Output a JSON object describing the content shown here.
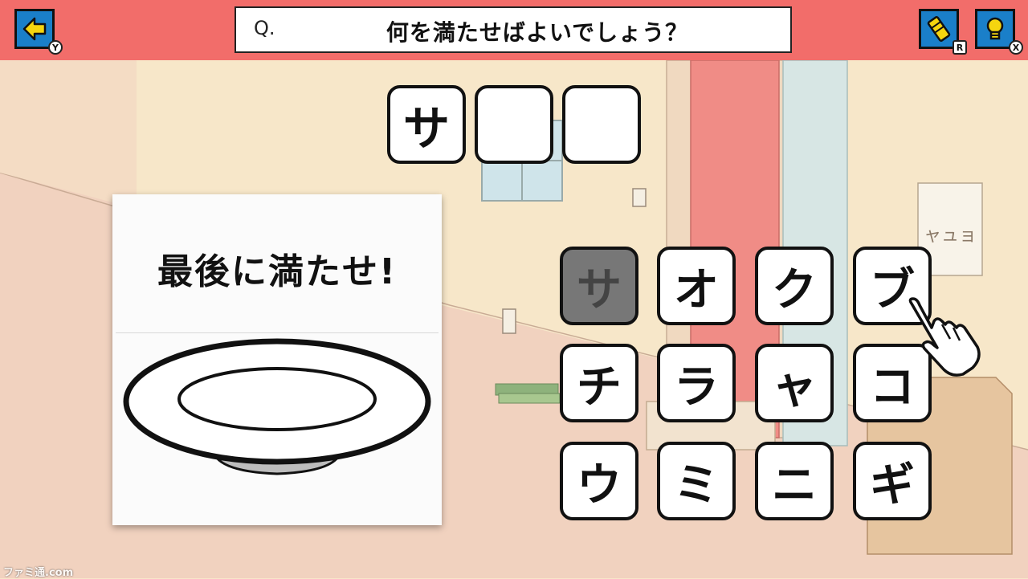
{
  "header": {
    "back_key": "Y",
    "question_prefix": "Q.",
    "question_text": "何を満たせばよいでしょう？",
    "eraser_key": "R",
    "hint_key": "X"
  },
  "answer": {
    "slots": [
      "サ",
      "",
      ""
    ]
  },
  "card": {
    "hint": "最後に満たせ!"
  },
  "tiles": [
    {
      "label": "サ",
      "used": true
    },
    {
      "label": "オ",
      "used": false
    },
    {
      "label": "ク",
      "used": false
    },
    {
      "label": "ブ",
      "used": false
    },
    {
      "label": "チ",
      "used": false
    },
    {
      "label": "ラ",
      "used": false
    },
    {
      "label": "ャ",
      "used": false
    },
    {
      "label": "コ",
      "used": false
    },
    {
      "label": "ウ",
      "used": false
    },
    {
      "label": "ミ",
      "used": false
    },
    {
      "label": "ニ",
      "used": false
    },
    {
      "label": "ギ",
      "used": false
    }
  ],
  "background": {
    "poster_text": "ャュョ"
  },
  "watermark": "ファミ通.com",
  "colors": {
    "header_bar": "#f26d6a",
    "button_blue": "#1a7fc9",
    "arrow_yellow": "#f5d50f",
    "wall": "#f7e7c9",
    "floor": "#f1d2bf",
    "used_tile": "#777777"
  }
}
